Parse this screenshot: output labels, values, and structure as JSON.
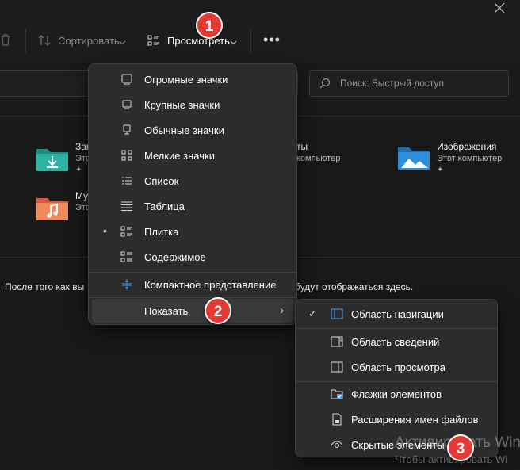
{
  "toolbar": {
    "sort_label": "Сортировать",
    "view_label": "Просмотреть",
    "more_label": "•••"
  },
  "search": {
    "placeholder": "Поиск: Быстрый доступ"
  },
  "quick_access": [
    {
      "title": "Заг",
      "subtitle": "Это",
      "icon": "downloads-folder-icon",
      "color": "#26a69a"
    },
    {
      "title": "ты",
      "subtitle": "компьютер",
      "icon": "documents-folder-icon",
      "color": "#555555"
    },
    {
      "title": "Изображения",
      "subtitle": "Этот компьютер",
      "icon": "pictures-folder-icon",
      "color": "#2d8fdc"
    },
    {
      "title": "Му",
      "subtitle": "Это",
      "icon": "music-folder-icon",
      "color": "#ef6c57"
    }
  ],
  "recent": {
    "note_left": "После того как вы",
    "note_right": "будут отображаться здесь."
  },
  "view_menu": {
    "items": [
      {
        "label": "Огромные значки",
        "icon": "monitor-icon"
      },
      {
        "label": "Крупные значки",
        "icon": "monitor-small-icon"
      },
      {
        "label": "Обычные значки",
        "icon": "monitor-stand-icon"
      },
      {
        "label": "Мелкие значки",
        "icon": "small-icons-grid-icon"
      },
      {
        "label": "Список",
        "icon": "list-icon"
      },
      {
        "label": "Таблица",
        "icon": "table-icon"
      },
      {
        "label": "Плитка",
        "icon": "tiles-icon",
        "selected": true
      },
      {
        "label": "Содержимое",
        "icon": "content-icon"
      },
      {
        "label": "Компактное представление",
        "icon": "compact-icon"
      },
      {
        "label": "Показать",
        "icon": "none",
        "has_submenu": true
      }
    ]
  },
  "show_menu": {
    "items": [
      {
        "label": "Область навигации",
        "icon": "nav-pane-icon",
        "checked": true
      },
      {
        "label": "Область сведений",
        "icon": "details-pane-icon"
      },
      {
        "label": "Область просмотра",
        "icon": "preview-pane-icon"
      },
      {
        "label": "Флажки элементов",
        "icon": "checkbox-icon"
      },
      {
        "label": "Расширения имен файлов",
        "icon": "file-icon"
      },
      {
        "label": "Скрытые элементы",
        "icon": "eye-icon"
      }
    ]
  },
  "badges": [
    "1",
    "2",
    "3"
  ],
  "watermark": {
    "line1": "Активировать Windo",
    "line2": "Чтобы активировать Wi"
  },
  "colors": {
    "background": "#191919",
    "menu": "#2c2c2c",
    "badge": "#e53935",
    "accent": "#4aa3f0"
  }
}
